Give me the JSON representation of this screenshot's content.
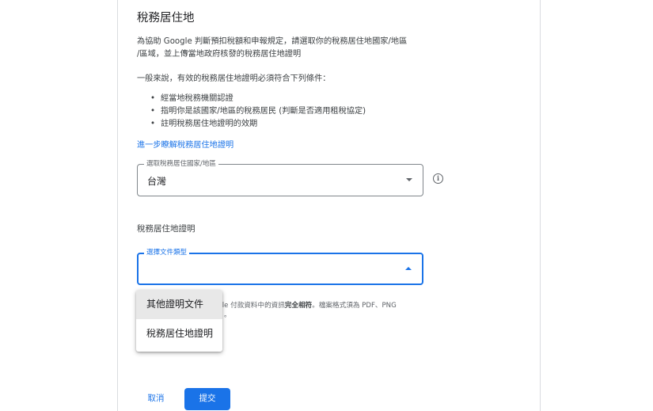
{
  "dialog": {
    "title": "稅務居住地",
    "intro_line1": "為協助 Google 判斷預扣稅額和申報規定，請選取你的稅務居住地國家/地區",
    "intro_line2": "/區域，並上傳當地政府核發的稅務居住地證明",
    "conditions_intro": "一般來說，有效的稅務居住地證明必須符合下列條件：",
    "conditions": [
      "經當地稅務機關認證",
      "指明你是該國家/地區的稅務居民 (判斷是否適用租稅協定)",
      "註明稅務居住地證明的效期"
    ],
    "learn_more_link": "進一步瞭解稅務居住地證明"
  },
  "country_field": {
    "label": "選取稅務居住國家/地區",
    "value": "台灣"
  },
  "certificate_section": {
    "heading": "稅務居住地證明"
  },
  "doctype_field": {
    "label": "選擇文件類型",
    "value": ""
  },
  "helper_text": {
    "prefix": "ogle 付款資料中的資訊",
    "bold": "完全相符",
    "suffix": "。檔案格式須為 PDF、PNG",
    "line2": "。"
  },
  "dropdown_menu": {
    "options": [
      "其他證明文件",
      "稅務居住地證明"
    ],
    "highlighted_index": 0
  },
  "actions": {
    "cancel_label": "取消",
    "submit_label": "提交"
  },
  "colors": {
    "accent": "#1a73e8",
    "text": "#202124",
    "secondary_text": "#5f6368"
  },
  "icons": {
    "country_dropdown": "chevron-down-icon",
    "doctype_dropdown": "chevron-up-icon",
    "info": "info-icon"
  }
}
